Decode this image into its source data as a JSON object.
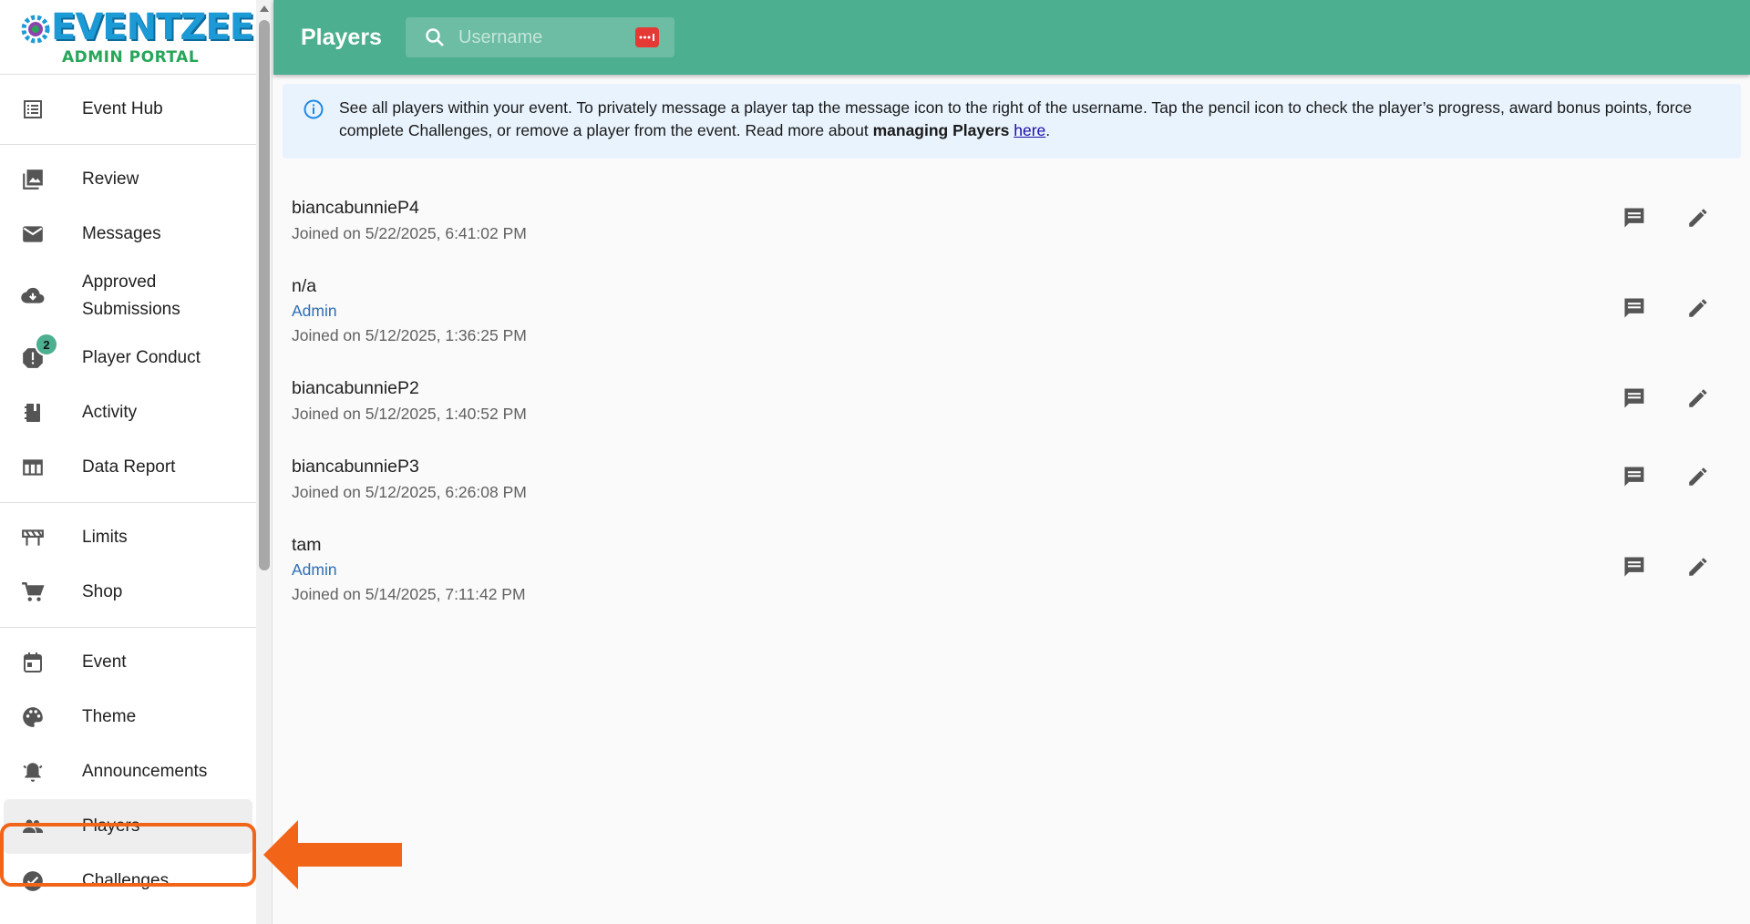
{
  "brand": {
    "name": "EVENTZEE",
    "subtitle": "ADMIN PORTAL"
  },
  "sidebar": {
    "groups": [
      [
        {
          "label": "Event Hub",
          "icon": "list-icon"
        }
      ],
      [
        {
          "label": "Review",
          "icon": "image-review-icon"
        },
        {
          "label": "Messages",
          "icon": "mail-icon"
        },
        {
          "label": "Approved Submissions",
          "icon": "cloud-download-icon"
        },
        {
          "label": "Player Conduct",
          "icon": "alert-icon",
          "badge": "2"
        },
        {
          "label": "Activity",
          "icon": "notebook-icon"
        },
        {
          "label": "Data Report",
          "icon": "table-icon"
        }
      ],
      [
        {
          "label": "Limits",
          "icon": "barrier-icon"
        },
        {
          "label": "Shop",
          "icon": "cart-icon"
        }
      ],
      [
        {
          "label": "Event",
          "icon": "calendar-icon"
        },
        {
          "label": "Theme",
          "icon": "palette-icon"
        },
        {
          "label": "Announcements",
          "icon": "bell-icon"
        },
        {
          "label": "Players",
          "icon": "people-icon",
          "active": true
        },
        {
          "label": "Challenges",
          "icon": "challenge-icon"
        }
      ]
    ]
  },
  "header": {
    "title": "Players",
    "search_placeholder": "Username",
    "search_value": ""
  },
  "info": {
    "text_before": "See all players within your event. To privately message a player tap the message icon to the right of the username. Tap the pencil icon to check the player’s progress, award bonus points, force complete Challenges, or remove a player from the event. Read more about ",
    "bold": "managing Players",
    "link": "here",
    "text_after": "."
  },
  "players": [
    {
      "username": "biancabunnieP4",
      "role": "",
      "joined": "Joined on 5/22/2025, 6:41:02 PM"
    },
    {
      "username": "n/a",
      "role": "Admin",
      "joined": "Joined on 5/12/2025, 1:36:25 PM"
    },
    {
      "username": "biancabunnieP2",
      "role": "",
      "joined": "Joined on 5/12/2025, 1:40:52 PM"
    },
    {
      "username": "biancabunnieP3",
      "role": "",
      "joined": "Joined on 5/12/2025, 6:26:08 PM"
    },
    {
      "username": "tam",
      "role": "Admin",
      "joined": "Joined on 5/14/2025, 7:11:42 PM"
    }
  ],
  "colors": {
    "header": "#4caf8f",
    "highlight": "#f26519",
    "link": "#1a0dab",
    "admin": "#2e6fb5",
    "banner": "#e8f3fd"
  }
}
